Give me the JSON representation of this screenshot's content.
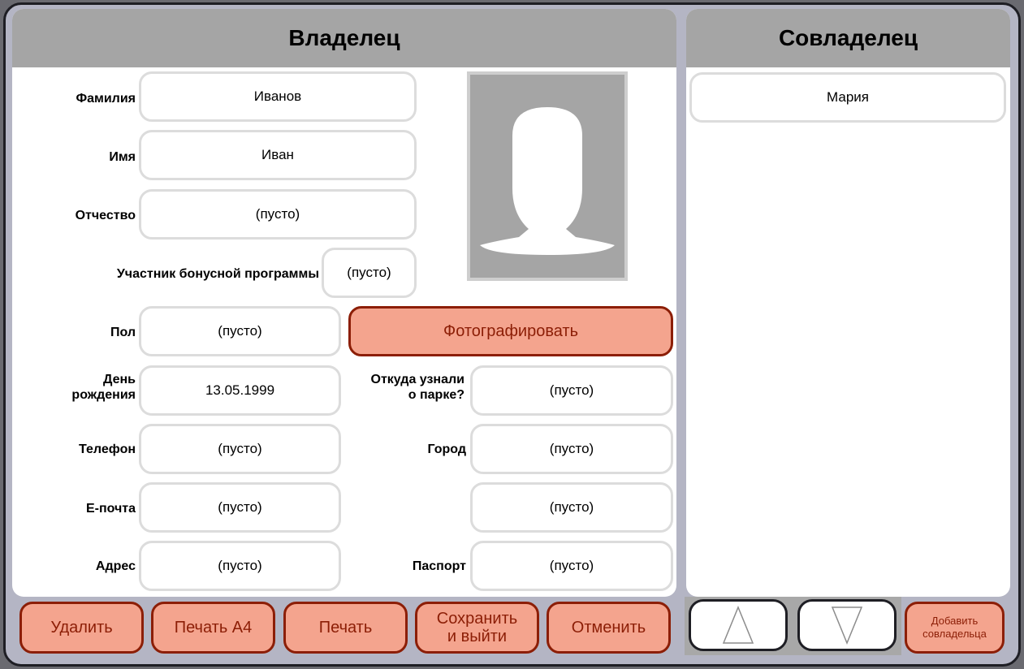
{
  "owner": {
    "title": "Владелец",
    "fields": {
      "last_name": {
        "label": "Фамилия",
        "value": "Иванов"
      },
      "first_name": {
        "label": "Имя",
        "value": "Иван"
      },
      "patronymic": {
        "label": "Отчество",
        "value": "(пусто)"
      },
      "bonus": {
        "label": "Участник бонусной программы",
        "value": "(пусто)"
      },
      "gender": {
        "label": "Пол",
        "value": "(пусто)"
      },
      "birthday": {
        "label_line1": "День",
        "label_line2": "рождения",
        "value": "13.05.1999"
      },
      "source": {
        "label_line1": "Откуда узнали",
        "label_line2": "о парке?",
        "value": "(пусто)"
      },
      "phone": {
        "label": "Телефон",
        "value": "(пусто)"
      },
      "city": {
        "label": "Город",
        "value": "(пусто)"
      },
      "email": {
        "label": "Е-почта",
        "value": "(пусто)"
      },
      "unlabeled": {
        "value": "(пусто)"
      },
      "address": {
        "label": "Адрес",
        "value": "(пусто)"
      },
      "passport": {
        "label": "Паспорт",
        "value": "(пусто)"
      }
    },
    "photo_icon": "user-silhouette-icon",
    "photograph_button": "Фотографировать"
  },
  "coowner": {
    "title": "Совладелец",
    "items": [
      "Мария"
    ]
  },
  "actions": {
    "delete": "Удалить",
    "print_a4": "Печать А4",
    "print": "Печать",
    "save_exit_line1": "Сохранить",
    "save_exit_line2": "и выйти",
    "cancel": "Отменить",
    "add_coowner_line1": "Добавить",
    "add_coowner_line2": "совладельца"
  },
  "icons": {
    "up": "triangle-up-icon",
    "down": "triangle-down-icon"
  },
  "colors": {
    "accent_fill": "#f4a48e",
    "accent_border": "#8c1e06",
    "header_gray": "#a5a5a5",
    "frame": "#b4b5c4"
  }
}
